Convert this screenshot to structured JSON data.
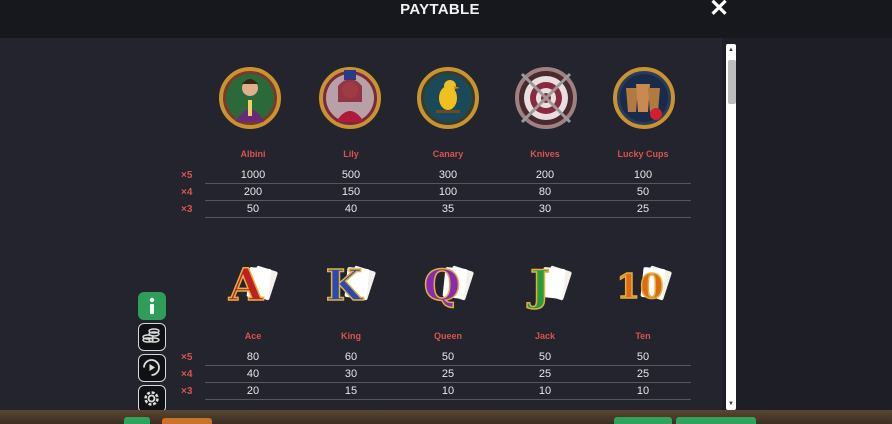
{
  "header": {
    "title": "PAYTABLE",
    "close_icon": "close-icon"
  },
  "premium": {
    "symbols": [
      "Albini",
      "Lily",
      "Canary",
      "Knives",
      "Lucky Cups"
    ],
    "multipliers": [
      "×5",
      "×4",
      "×3"
    ],
    "rows": [
      [
        "1000",
        "500",
        "300",
        "200",
        "100"
      ],
      [
        "200",
        "150",
        "100",
        "80",
        "50"
      ],
      [
        "50",
        "40",
        "35",
        "30",
        "25"
      ]
    ]
  },
  "royals": {
    "symbols": [
      "Ace",
      "King",
      "Queen",
      "Jack",
      "Ten"
    ],
    "glyphs": [
      "A",
      "K",
      "Q",
      "J",
      "10"
    ],
    "multipliers": [
      "×5",
      "×4",
      "×3"
    ],
    "rows": [
      [
        "80",
        "60",
        "50",
        "50",
        "50"
      ],
      [
        "40",
        "30",
        "25",
        "25",
        "25"
      ],
      [
        "20",
        "15",
        "10",
        "10",
        "10"
      ]
    ]
  },
  "sidebar": {
    "info_icon": "info-icon",
    "coins_icon": "coins-icon",
    "autoplay_icon": "autoplay-icon",
    "settings_icon": "gear-icon"
  },
  "colors": {
    "accent": "#d9534f",
    "green": "#2f9e5b",
    "background": "#23242d"
  }
}
